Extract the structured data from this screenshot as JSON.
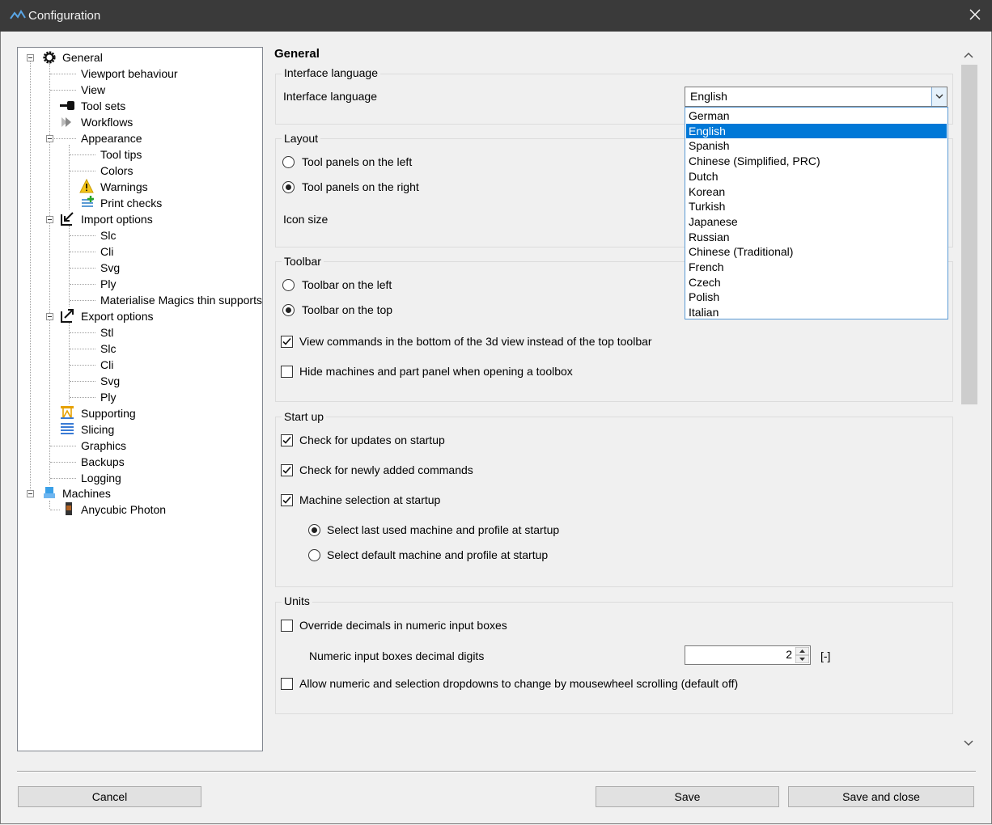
{
  "window": {
    "title": "Configuration"
  },
  "tree": {
    "general": "General",
    "viewport_behaviour": "Viewport behaviour",
    "view": "View",
    "tool_sets": "Tool sets",
    "workflows": "Workflows",
    "appearance": "Appearance",
    "tool_tips": "Tool tips",
    "colors": "Colors",
    "warnings": "Warnings",
    "print_checks": "Print checks",
    "import_options": "Import options",
    "import_slc": "Slc",
    "import_cli": "Cli",
    "import_svg": "Svg",
    "import_ply": "Ply",
    "import_mm": "Materialise Magics thin supports",
    "export_options": "Export options",
    "export_stl": "Stl",
    "export_slc": "Slc",
    "export_cli": "Cli",
    "export_svg": "Svg",
    "export_ply": "Ply",
    "supporting": "Supporting",
    "slicing": "Slicing",
    "graphics": "Graphics",
    "backups": "Backups",
    "logging": "Logging",
    "machines": "Machines",
    "anycubic": "Anycubic Photon"
  },
  "main": {
    "heading": "General",
    "interface_language": {
      "group_title": "Interface language",
      "label": "Interface language",
      "value": "English",
      "options": [
        "German",
        "English",
        "Spanish",
        "Chinese (Simplified, PRC)",
        "Dutch",
        "Korean",
        "Turkish",
        "Japanese",
        "Russian",
        "Chinese (Traditional)",
        "French",
        "Czech",
        "Polish",
        "Italian"
      ],
      "selected_index": 1
    },
    "layout": {
      "group_title": "Layout",
      "left": "Tool panels on the left",
      "right": "Tool panels on the right",
      "icon_size": "Icon size"
    },
    "toolbar": {
      "group_title": "Toolbar",
      "left": "Toolbar on the left",
      "top": "Toolbar on the top",
      "view_commands": "View commands in the bottom of the 3d view instead of the top toolbar",
      "hide_machines": "Hide machines and part panel when opening a toolbox"
    },
    "startup": {
      "group_title": "Start up",
      "check_updates": "Check for updates on startup",
      "check_new_commands": "Check for newly added commands",
      "machine_selection": "Machine selection at startup",
      "last_used": "Select last used machine and profile at startup",
      "default_machine": "Select default machine and profile at startup"
    },
    "units": {
      "group_title": "Units",
      "override": "Override decimals in numeric input boxes",
      "decimal_digits_label": "Numeric input boxes decimal digits",
      "decimal_digits_value": "2",
      "unit": "[-]",
      "mousewheel": "Allow numeric and selection dropdowns to change by mousewheel scrolling (default off)"
    }
  },
  "footer": {
    "cancel": "Cancel",
    "save": "Save",
    "save_close": "Save and close"
  }
}
